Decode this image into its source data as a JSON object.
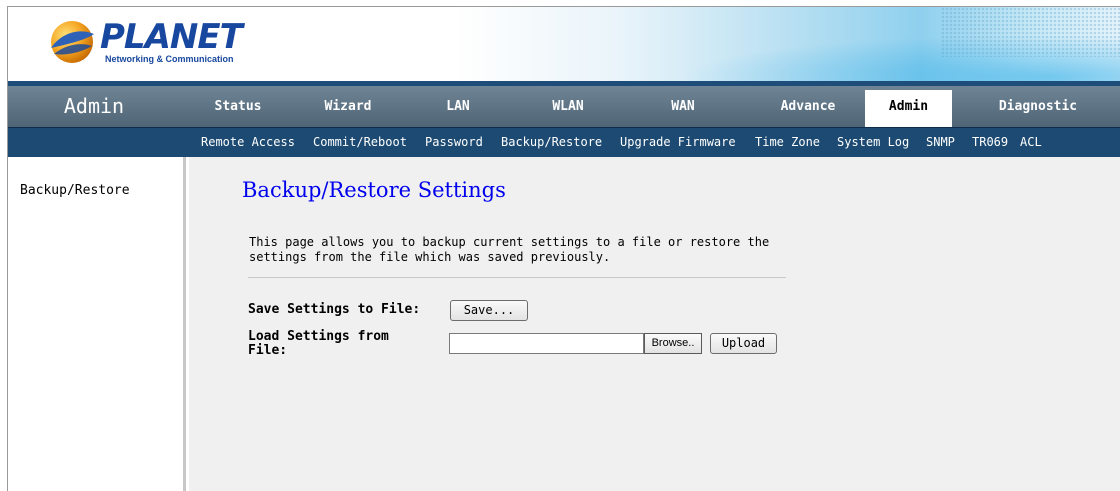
{
  "brand": {
    "name": "PLANET",
    "tagline": "Networking & Communication"
  },
  "section_title": "Admin",
  "main_nav": [
    {
      "label": "Status",
      "active": false
    },
    {
      "label": "Wizard",
      "active": false
    },
    {
      "label": "LAN",
      "active": false
    },
    {
      "label": "WLAN",
      "active": false
    },
    {
      "label": "WAN",
      "active": false
    },
    {
      "label": "Advance",
      "active": false
    },
    {
      "label": "Admin",
      "active": true
    },
    {
      "label": "Diagnostic",
      "active": false
    }
  ],
  "sub_nav": [
    "Remote Access",
    "Commit/Reboot",
    "Password",
    "Backup/Restore",
    "Upgrade Firmware",
    "Time Zone",
    "System Log",
    "SNMP",
    "TR069",
    "ACL"
  ],
  "sidebar": {
    "items": [
      "Backup/Restore"
    ]
  },
  "main": {
    "title": "Backup/Restore Settings",
    "description": "This page allows you to backup current settings to a file or restore the settings from the file which was saved previously.",
    "save_label": "Save Settings to File:",
    "save_button": "Save...",
    "load_label": "Load Settings from File:",
    "file_value": "",
    "browse_button": "Browse..",
    "upload_button": "Upload"
  },
  "colors": {
    "nav_bg": "#5e7486",
    "subnav_bg": "#1c4a72",
    "title_blue": "#0000ee",
    "content_bg": "#f0f0f0"
  }
}
